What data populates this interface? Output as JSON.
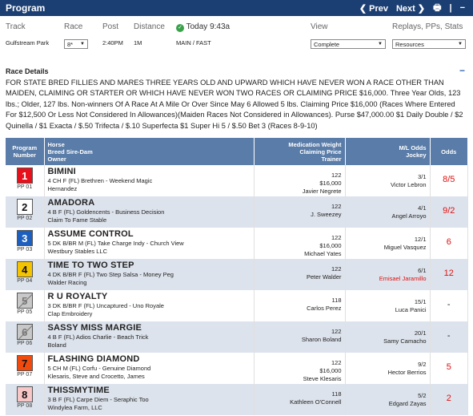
{
  "topbar": {
    "title": "Program",
    "prev": "❮ Prev",
    "next": "Next ❯",
    "print_icon": "printer-icon",
    "minimize_icon": "minimize-icon"
  },
  "filters": {
    "track_label": "Track",
    "race_label": "Race",
    "post_label": "Post",
    "distance_label": "Distance",
    "status_label": "Today 9:43a",
    "view_label": "View",
    "replays_label": "Replays, PPs, Stats",
    "track_value": "Gulfstream Park",
    "race_value": "8*",
    "post_value": "2:40PM",
    "distance_value": "1M",
    "surface_value": "MAIN / FAST",
    "view_value": "Complete",
    "resources_value": "Resources"
  },
  "race_details": {
    "title": "Race Details",
    "text": "FOR STATE BRED FILLIES AND MARES THREE YEARS OLD AND UPWARD WHICH HAVE NEVER WON A RACE OTHER THAN MAIDEN, CLAIMING OR STARTER OR WHICH HAVE NEVER WON TWO RACES OR CLAIMING PRICE $16,000. Three Year Olds, 123 lbs.; Older, 127 lbs. Non-winners Of A Race At A Mile Or Over Since May 6 Allowed 5 lbs. Claiming Price $16,000 (Races Where Entered For $12,500 Or Less Not Considered In Allowances)(Maiden Races Not Considered in Allowances). Purse $47,000.00 $1 Daily Double / $2 Quinella / $1 Exacta / $.50 Trifecta / $.10 Superfecta $1 Super Hi 5 / $.50 Bet 3 (Races 8-9-10)"
  },
  "table": {
    "headers": {
      "program": "Program Number",
      "horse": "Horse\nBreed Sire-Dam\nOwner",
      "mwc": "Medication Weight\nClaiming Price\nTrainer",
      "ml": "M/L Odds\nJockey",
      "odds": "Odds"
    },
    "rows": [
      {
        "num": "1",
        "pp": "PP 01",
        "bg": "#e8101a",
        "fg": "#ffffff",
        "scratched": false,
        "name": "BIMINI",
        "breed": "4 CH F (FL) Brethren - Weekend Magic",
        "owner": "Hernandez",
        "weight": "122",
        "claim": "$16,000",
        "trainer": "Javier Negrete",
        "ml": "3/1",
        "jockey": "Victor Lebron",
        "odds": "8/5",
        "odds_red": true
      },
      {
        "num": "2",
        "pp": "PP 02",
        "bg": "#ffffff",
        "fg": "#111111",
        "scratched": false,
        "name": "AMADORA",
        "breed": "4 B F (FL) Goldencents - Business Decision",
        "owner": "Claim To Fame Stable",
        "weight": "122",
        "claim": "",
        "trainer": "J. Sweezey",
        "ml": "4/1",
        "jockey": "Angel Arroyo",
        "odds": "9/2",
        "odds_red": true
      },
      {
        "num": "3",
        "pp": "PP 03",
        "bg": "#1d5fbf",
        "fg": "#ffffff",
        "scratched": false,
        "name": "ASSUME CONTROL",
        "breed": "5 DK B/BR M (FL) Take Charge Indy - Church View",
        "owner": "Westbury Stables LLC",
        "weight": "122",
        "claim": "$16,000",
        "trainer": "Michael Yates",
        "ml": "12/1",
        "jockey": "Miguel Vasquez",
        "odds": "6",
        "odds_red": true
      },
      {
        "num": "4",
        "pp": "PP 04",
        "bg": "#f5c400",
        "fg": "#111111",
        "scratched": false,
        "name": "TIME TO TWO STEP",
        "breed": "4 DK B/BR F (FL) Two Step Salsa - Money Peg",
        "owner": "Walder Racing",
        "weight": "122",
        "claim": "",
        "trainer": "Peter Walder",
        "ml": "6/1",
        "jockey": "Emisael Jaramillo",
        "jockey_red": true,
        "odds": "12",
        "odds_red": true
      },
      {
        "num": "5",
        "pp": "PP 05",
        "bg": "#c8c8c8",
        "fg": "#777777",
        "scratched": true,
        "name": "R U ROYALTY",
        "breed": "3 DK B/BR F (FL) Uncaptured - Uno Royale",
        "owner": "Clap Embroidery",
        "weight": "118",
        "claim": "",
        "trainer": "Carlos Perez",
        "ml": "15/1",
        "jockey": "Luca Panici",
        "odds": "-",
        "odds_red": false
      },
      {
        "num": "6",
        "pp": "PP 06",
        "bg": "#c8c8c8",
        "fg": "#777777",
        "scratched": true,
        "name": "SASSY MISS MARGIE",
        "breed": "4 B F (FL) Adios Charlie - Beach Trick",
        "owner": "Boland",
        "weight": "122",
        "claim": "",
        "trainer": "Sharon Boland",
        "ml": "20/1",
        "jockey": "Samy Camacho",
        "odds": "-",
        "odds_red": false
      },
      {
        "num": "7",
        "pp": "PP 07",
        "bg": "#f04a0e",
        "fg": "#111111",
        "scratched": false,
        "name": "FLASHING DIAMOND",
        "breed": "5 CH M (FL) Corfu - Genuine Diamond",
        "owner": "Klesaris, Steve and Crocetto, James",
        "weight": "122",
        "claim": "$16,000",
        "trainer": "Steve Klesaris",
        "ml": "9/2",
        "jockey": "Hector Berrios",
        "odds": "5",
        "odds_red": true
      },
      {
        "num": "8",
        "pp": "PP 08",
        "bg": "#f7c6c6",
        "fg": "#111111",
        "scratched": false,
        "name": "THISSMYTIME",
        "breed": "3 B F (FL) Carpe Diem - Seraphic Too",
        "owner": "Windylea Farm, LLC",
        "weight": "118",
        "claim": "",
        "trainer": "Kathleen O'Connell",
        "ml": "5/2",
        "jockey": "Edgard Zayas",
        "odds": "2",
        "odds_red": true
      }
    ]
  }
}
